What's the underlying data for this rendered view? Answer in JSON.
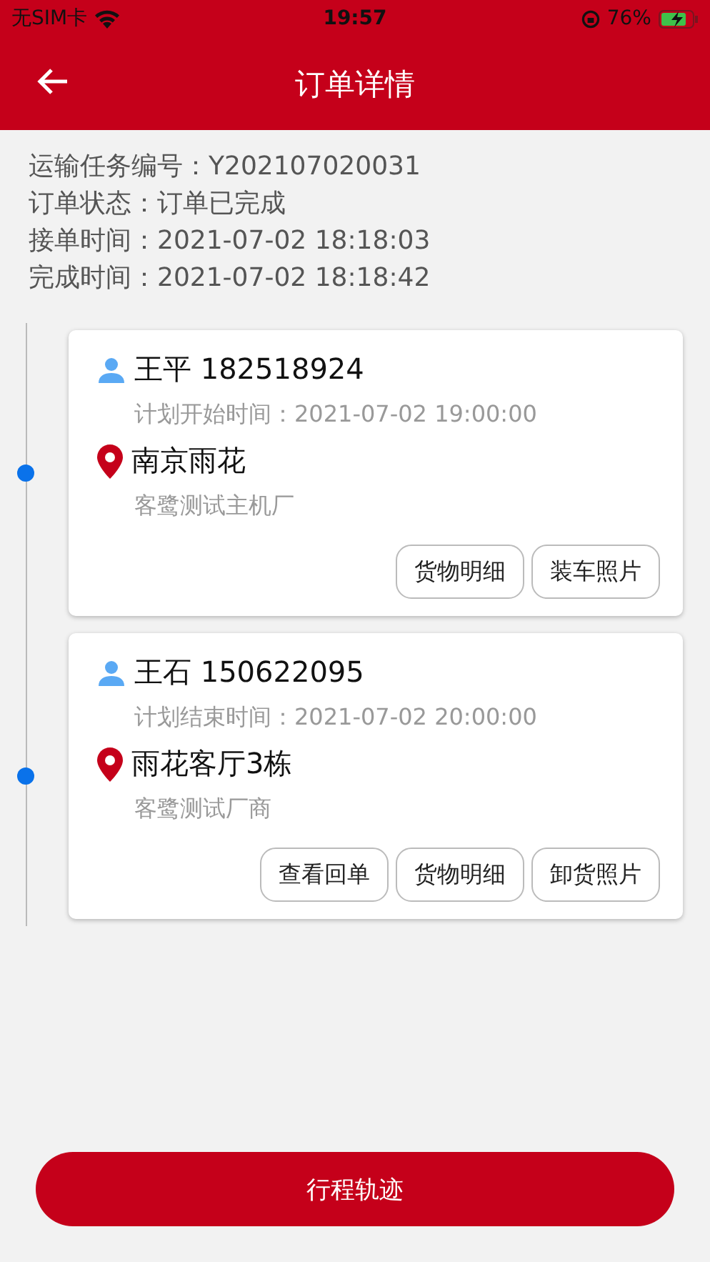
{
  "status_bar": {
    "carrier": "无SIM卡",
    "time": "19:57",
    "battery": "76%"
  },
  "header": {
    "title": "订单详情"
  },
  "info": [
    "运输任务编号：Y202107020031",
    "订单状态：订单已完成",
    "接单时间：2021-07-02 18:18:03",
    "完成时间：2021-07-02 18:18:42"
  ],
  "stops": [
    {
      "name": "王平",
      "phone": "182518924",
      "plan_time": "计划开始时间：2021-07-02 19:00:00",
      "place": "南京雨花",
      "company": "客鹭测试主机厂",
      "buttons": [
        "货物明细",
        "装车照片"
      ]
    },
    {
      "name": "王石",
      "phone": "150622095",
      "plan_time": "计划结束时间：2021-07-02 20:00:00",
      "place": "雨花客厅3栋",
      "company": "客鹭测试厂商",
      "buttons": [
        "查看回单",
        "货物明细",
        "卸货照片"
      ]
    }
  ],
  "bottom_button": "行程轨迹"
}
